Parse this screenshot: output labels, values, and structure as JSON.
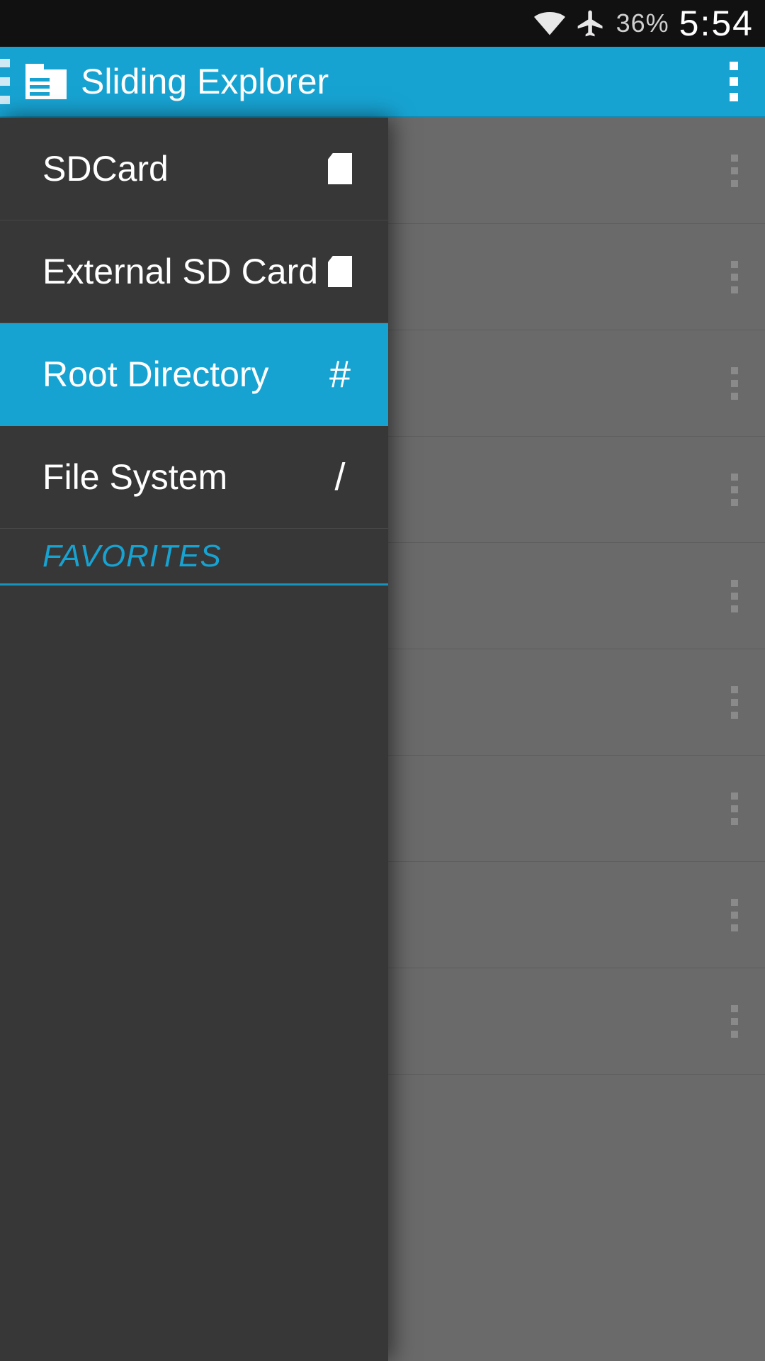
{
  "status": {
    "battery_pct": "36%",
    "clock": "5:54"
  },
  "actionbar": {
    "title": "Sliding Explorer"
  },
  "drawer": {
    "items": [
      {
        "label": "SDCard",
        "icon": "sdcard"
      },
      {
        "label": "External SD Card",
        "icon": "sdcard"
      },
      {
        "label": "Root Directory",
        "icon": "#",
        "selected": true
      },
      {
        "label": "File System",
        "icon": "/"
      }
    ],
    "favorites_label": "FAVORITES"
  },
  "filelist": {
    "visible_rows": 9
  }
}
